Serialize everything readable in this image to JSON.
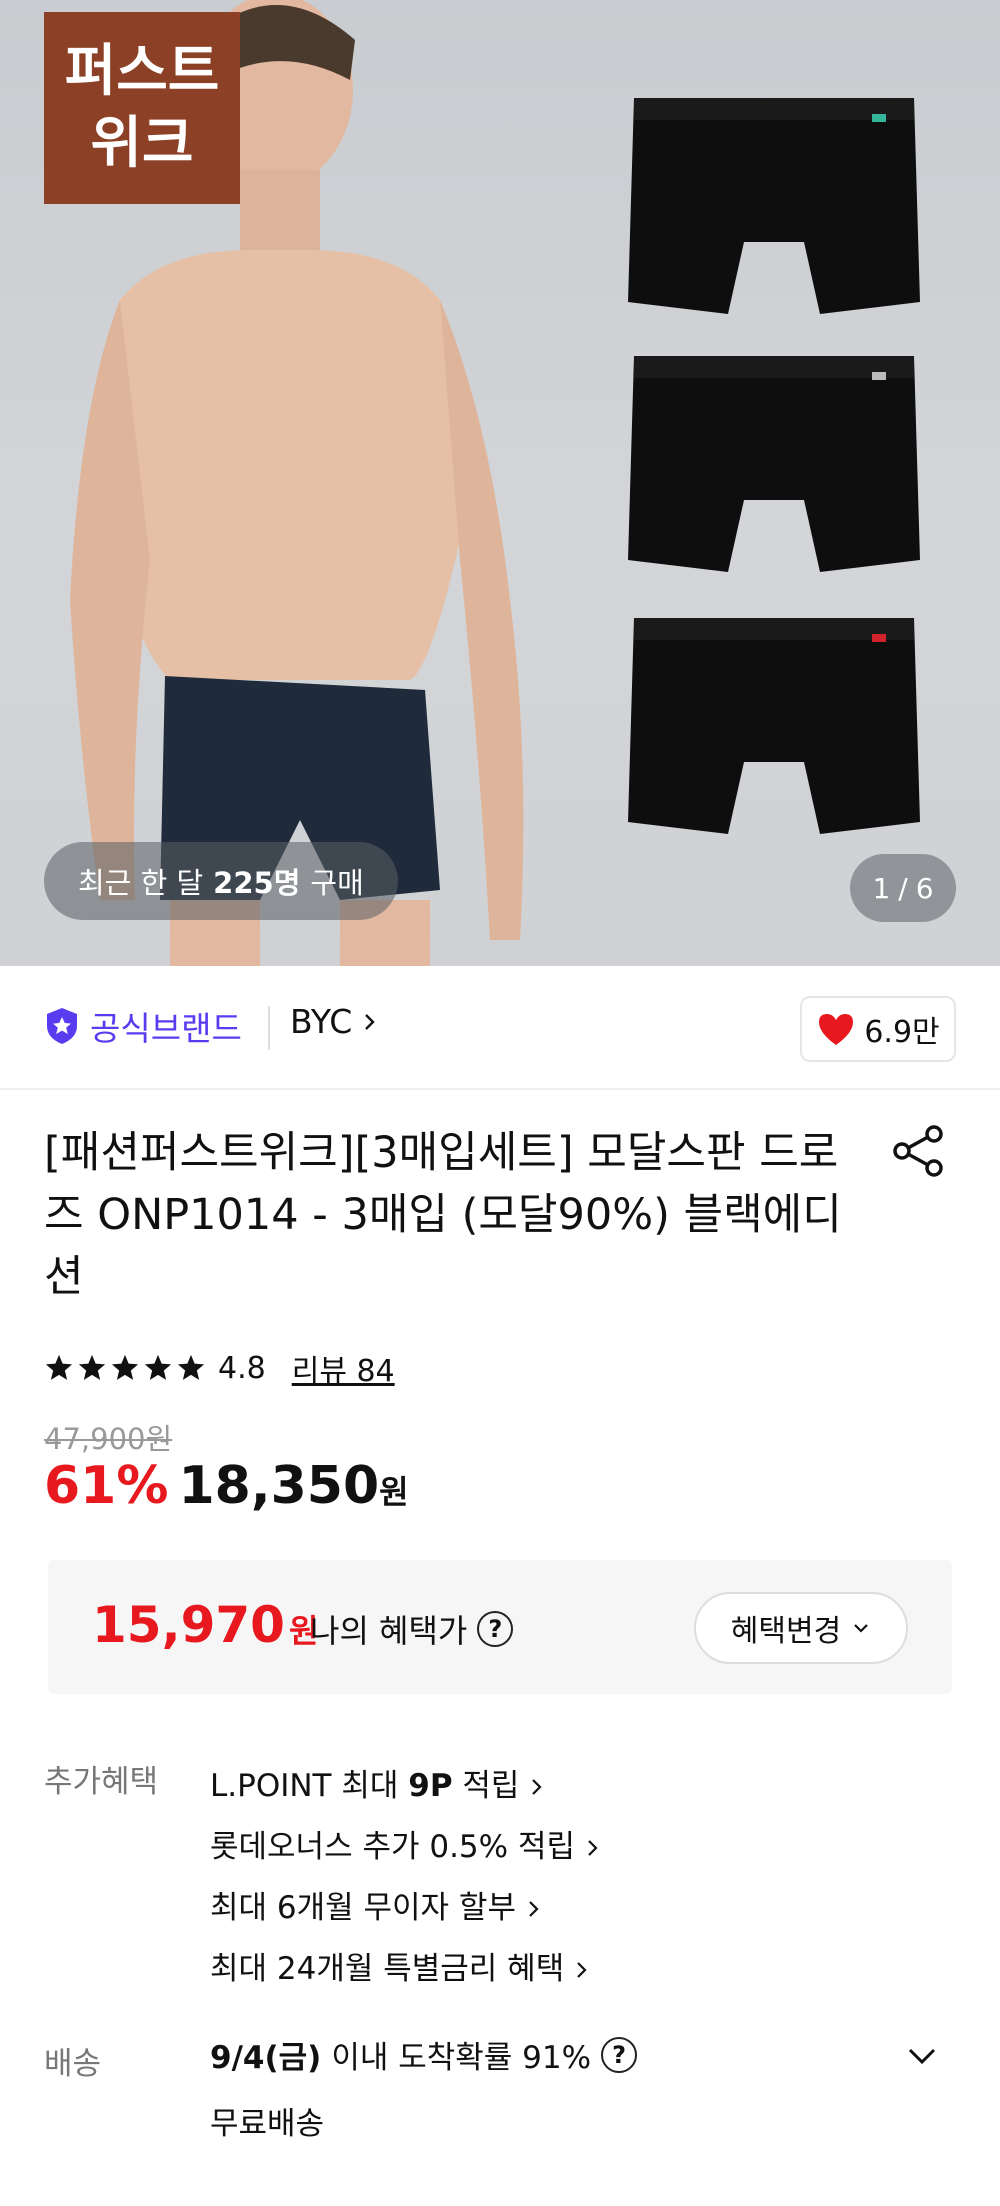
{
  "hero": {
    "badge_line1": "퍼스트",
    "badge_line2": "위크",
    "purchase_prefix": "최근 한 달",
    "purchase_count": "225명",
    "purchase_suffix": "구매",
    "page_current": "1",
    "page_sep": "/",
    "page_total": "6"
  },
  "brand": {
    "official_label": "공식브랜드",
    "name": "BYC",
    "likes": "6.9만"
  },
  "product": {
    "title": "[패션퍼스트위크][3매입세트] 모달스판 드로즈 ONP1014 - 3매입 (모달90%) 블랙에디션",
    "rating": "4.8",
    "review_label": "리뷰 84",
    "original_price": "47,900원",
    "discount": "61%",
    "price": "18,350",
    "price_unit": "원"
  },
  "benefit": {
    "amount": "15,970",
    "unit": "원",
    "label": "나의 혜택가",
    "change_label": "혜택변경"
  },
  "extra": {
    "section_label": "추가혜택",
    "items": [
      {
        "pre": "L.POINT 최대 ",
        "bold": "9P",
        "post": " 적립"
      },
      {
        "pre": "롯데오너스 추가 0.5% 적립",
        "bold": "",
        "post": ""
      },
      {
        "pre": "최대 6개월 무이자 할부",
        "bold": "",
        "post": ""
      },
      {
        "pre": "최대 24개월 특별금리 혜택",
        "bold": "",
        "post": ""
      }
    ]
  },
  "shipping": {
    "section_label": "배송",
    "date": "9/4(금)",
    "probability_text": "이내 도착확률 91%",
    "fee": "무료배송"
  },
  "colors": {
    "accent_red": "#e7191f",
    "official_purple": "#5a3cf0",
    "badge_brown": "#8c4026"
  }
}
